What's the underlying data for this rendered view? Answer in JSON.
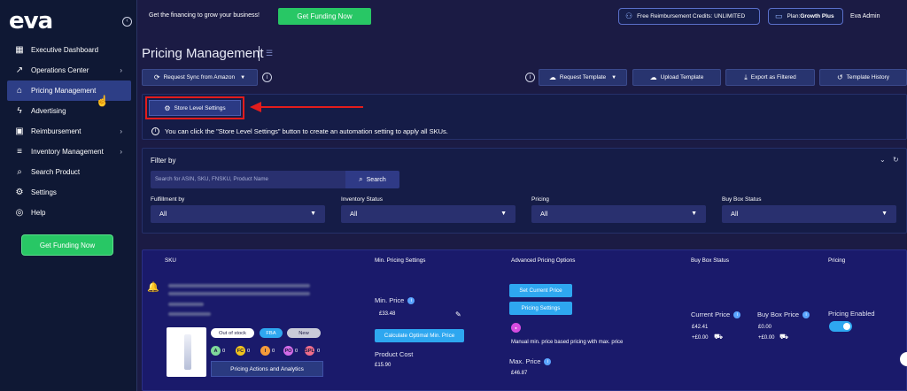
{
  "app": {
    "logo": "eva",
    "collapse_icon": "circle-chevron-icon"
  },
  "sidebar": {
    "items": [
      {
        "label": "Executive Dashboard",
        "icon": "grid-icon",
        "glyph": "▦",
        "has_children": false
      },
      {
        "label": "Operations Center",
        "icon": "trend-icon",
        "glyph": "↗",
        "has_children": true
      },
      {
        "label": "Pricing Management",
        "icon": "tag-icon",
        "glyph": "⌂",
        "has_children": false,
        "active": true
      },
      {
        "label": "Advertising",
        "icon": "bolt-icon",
        "glyph": "ϟ",
        "has_children": false
      },
      {
        "label": "Reimbursement",
        "icon": "box-icon",
        "glyph": "▣",
        "has_children": true
      },
      {
        "label": "Inventory Management",
        "icon": "stack-icon",
        "glyph": "≡",
        "has_children": true
      },
      {
        "label": "Search Product",
        "icon": "search-icon",
        "glyph": "⌕",
        "has_children": false
      },
      {
        "label": "Settings",
        "icon": "gear-icon",
        "glyph": "⚙",
        "has_children": false
      },
      {
        "label": "Help",
        "icon": "lifebuoy-icon",
        "glyph": "◎",
        "has_children": false
      }
    ],
    "chevron": "›",
    "funding_button": "Get Funding Now"
  },
  "topbar": {
    "message": "Get the financing to grow your business!",
    "funding_button": "Get Funding Now",
    "credits": "Free Reimbursement Credits: UNLIMITED",
    "plan_prefix": "Plan: ",
    "plan_name": "Growth Plus",
    "user": "Eva Admin"
  },
  "page": {
    "title": "Pricing Management"
  },
  "toolbar": {
    "request_sync": "Request Sync from Amazon",
    "request_template": "Request Template",
    "upload_template": "Upload Template",
    "export_filtered": "Export as Filtered",
    "template_history": "Template History"
  },
  "store": {
    "button": "Store Level Settings",
    "hint": "You can click the \"Store Level Settings\" button to create an automation setting to apply all SKUs."
  },
  "filter": {
    "title": "Filter by",
    "search_placeholder": "Search for ASIN, SKU, FNSKU, Product Name",
    "search_button": "Search",
    "fields": [
      {
        "label": "Fulfillment by",
        "value": "All"
      },
      {
        "label": "Inventory Status",
        "value": "All"
      },
      {
        "label": "Pricing",
        "value": "All"
      },
      {
        "label": "Buy Box Status",
        "value": "All"
      }
    ]
  },
  "table": {
    "headers": [
      "SKU",
      "Min. Pricing Settings",
      "Advanced Pricing Options",
      "Buy Box Status",
      "Pricing"
    ],
    "row": {
      "badges": [
        "Out of stock",
        "FBA",
        "New"
      ],
      "dots": [
        {
          "letter": "A",
          "count": "0",
          "color": "#7fd89a"
        },
        {
          "letter": "FC",
          "count": "0",
          "color": "#f2c31c"
        },
        {
          "letter": "I",
          "count": "0",
          "color": "#f59b3a"
        },
        {
          "letter": "PO",
          "count": "0",
          "color": "#d46be8"
        },
        {
          "letter": "SPL",
          "count": "0",
          "color": "#f06d8b"
        }
      ],
      "actions_button": "Pricing Actions and Analytics",
      "min_price_label": "Min. Price",
      "min_price_value": "£33.48",
      "calc_button": "Calculate Optimal Min. Price",
      "product_cost_label": "Product Cost",
      "product_cost_value": "£15.90",
      "set_current_button": "Set Current Price",
      "pricing_settings_button": "Pricing Settings",
      "strategy_text": "Manual min. price based pricing with max. price",
      "max_price_label": "Max. Price",
      "max_price_value": "£46.87",
      "current_price_label": "Current Price",
      "current_price_value": "£42.41",
      "current_shipping": "+£0.00",
      "buybox_price_label": "Buy Box Price",
      "buybox_price_value": "£0.00",
      "buybox_shipping": "+£0.00",
      "pricing_enabled_label": "Pricing Enabled",
      "pricing_enabled": true
    }
  }
}
